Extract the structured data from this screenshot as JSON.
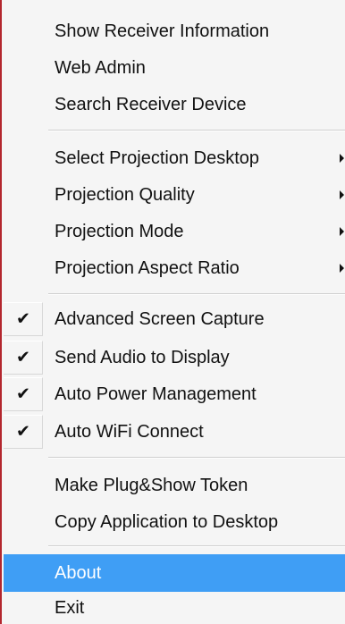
{
  "menu": {
    "items": [
      {
        "label": "Show Receiver Information"
      },
      {
        "label": "Web Admin"
      },
      {
        "label": "Search Receiver Device"
      },
      {
        "label": "Select Projection Desktop",
        "submenu": true
      },
      {
        "label": "Projection Quality",
        "submenu": true
      },
      {
        "label": "Projection Mode",
        "submenu": true
      },
      {
        "label": "Projection Aspect Ratio",
        "submenu": true
      },
      {
        "label": "Advanced Screen Capture",
        "checked": true
      },
      {
        "label": "Send Audio to Display",
        "checked": true
      },
      {
        "label": "Auto Power Management",
        "checked": true
      },
      {
        "label": "Auto WiFi Connect",
        "checked": true
      },
      {
        "label": "Make Plug&Show Token"
      },
      {
        "label": "Copy Application to Desktop"
      },
      {
        "label": "About",
        "highlighted": true
      },
      {
        "label": "Exit"
      }
    ],
    "check_glyph": "✔",
    "colors": {
      "highlight": "#3f9ef5",
      "background": "#f5f5f5",
      "left_border": "#b3262e"
    }
  }
}
